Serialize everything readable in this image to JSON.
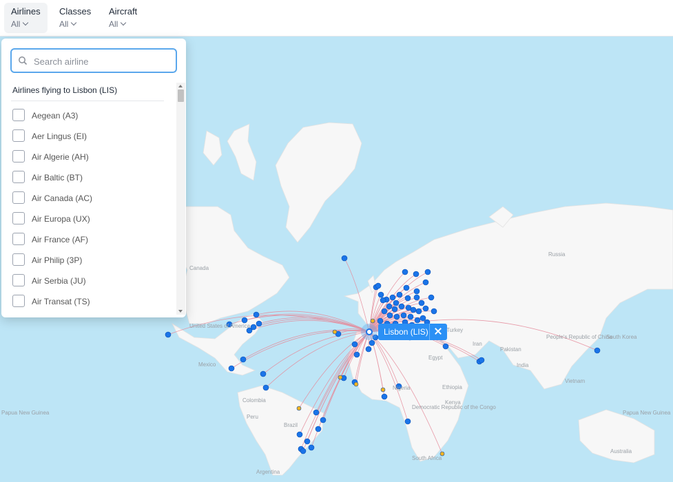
{
  "filters": [
    {
      "label": "Airlines",
      "value": "All"
    },
    {
      "label": "Classes",
      "value": "All"
    },
    {
      "label": "Aircraft",
      "value": "All"
    }
  ],
  "dropdown": {
    "search_placeholder": "Search airline",
    "list_title": "Airlines flying to Lisbon (LIS)",
    "airlines": [
      "Aegean (A3)",
      "Aer Lingus (EI)",
      "Air Algerie (AH)",
      "Air Baltic (BT)",
      "Air Canada (AC)",
      "Air Europa (UX)",
      "Air France (AF)",
      "Air Philip (3P)",
      "Air Serbia (JU)",
      "Air Transat (TS)"
    ]
  },
  "map": {
    "selected_airport": "Lisbon (LIS)",
    "labels": {
      "canada": "Canada",
      "usa": "United States of America",
      "mexico": "Mexico",
      "colombia": "Colombia",
      "peru": "Peru",
      "brazil": "Brazil",
      "argentina": "Argentina",
      "russia": "Russia",
      "china": "People's Republic of China",
      "south_korea": "South Korea",
      "iran": "Iran",
      "pakistan": "Pakistan",
      "india": "India",
      "vietnam": "Vietnam",
      "egypt": "Egypt",
      "ethiopia": "Ethiopia",
      "nigeria": "Nigeria",
      "kenya": "Kenya",
      "drc": "Democratic Republic of the Congo",
      "south_africa": "South Africa",
      "australia": "Australia",
      "turkey": "Turkey",
      "papua_left": "Papua New Guinea",
      "papua_right": "Papua New Guinea"
    },
    "colors": {
      "ocean": "#bde5f6",
      "land": "#f7f7f7",
      "route": "#e58a9a",
      "airport": "#1a74e8",
      "airport_alt": "#f2b321",
      "accent": "#2b90f5"
    }
  }
}
